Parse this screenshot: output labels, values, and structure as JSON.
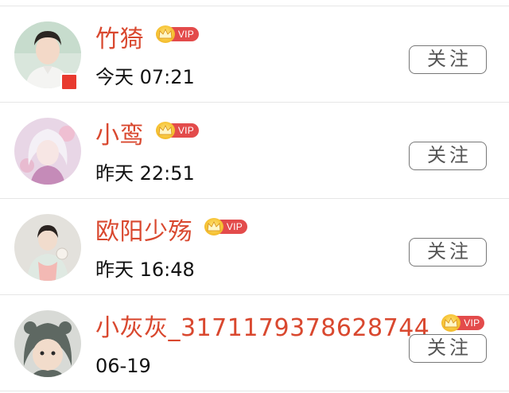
{
  "follow_list": [
    {
      "name": "竹猗",
      "vip_label": "VIP",
      "time": "今天 07:21",
      "follow_label": "关注",
      "avatar_icon": "avatar-man-portrait",
      "badge_icon": "red-flag-badge"
    },
    {
      "name": "小鸾",
      "vip_label": "VIP",
      "time": "昨天 22:51",
      "follow_label": "关注",
      "avatar_icon": "avatar-anime-girl"
    },
    {
      "name": "欧阳少殇",
      "vip_label": "VIP",
      "time": "昨天 16:48",
      "follow_label": "关注",
      "avatar_icon": "avatar-woman-hanfu"
    },
    {
      "name": "小灰灰_3171179378628744",
      "vip_label": "VIP",
      "time": "06-19",
      "follow_label": "关注",
      "avatar_icon": "avatar-baby-hood"
    }
  ],
  "colors": {
    "name": "#d9482f",
    "vip_pill": "#e34b4b",
    "vip_crown": "#f6c233",
    "follow_border": "#777777",
    "divider": "#e6e6e6"
  }
}
